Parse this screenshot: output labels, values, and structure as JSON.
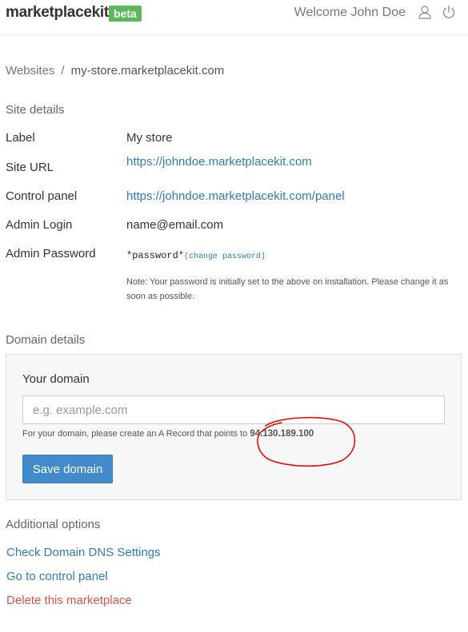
{
  "header": {
    "brand": "marketplacekit",
    "badge": "beta",
    "welcome": "Welcome John Doe",
    "icons": [
      "user-icon",
      "power-icon"
    ]
  },
  "breadcrumb": {
    "root": "Websites",
    "separator": "/",
    "current": "my-store.marketplacekit.com"
  },
  "site_details": {
    "heading": "Site details",
    "label_label": "Label",
    "label_value": "My store",
    "url_label": "Site URL",
    "url_value": "https://johndoe.marketplacekit.com",
    "panel_label": "Control panel",
    "panel_value": "https://johndoe.marketplacekit.com/panel",
    "login_label": "Admin Login",
    "login_value": "name@email.com",
    "password_label": "Admin Password",
    "password_value": "*password*",
    "change_password": "(change password)",
    "note": "Note: Your password is initially set to the above on installation. Please change it as soon as possible."
  },
  "domain_details": {
    "heading": "Domain details",
    "box_title": "Your domain",
    "input_placeholder": "e.g. example.com",
    "input_value": "",
    "help_text": "For your domain, please create an A Record that points to ",
    "ip": "94.130.189.100",
    "save_label": "Save domain"
  },
  "additional": {
    "heading": "Additional options",
    "check_dns": "Check Domain DNS Settings",
    "control_panel": "Go to control panel",
    "delete": "Delete this marketplace"
  },
  "colors": {
    "badge": "#5cb85c",
    "link": "#337ab7",
    "button": "#428bca",
    "danger": "#d9534f",
    "annotation": "#e01010"
  }
}
